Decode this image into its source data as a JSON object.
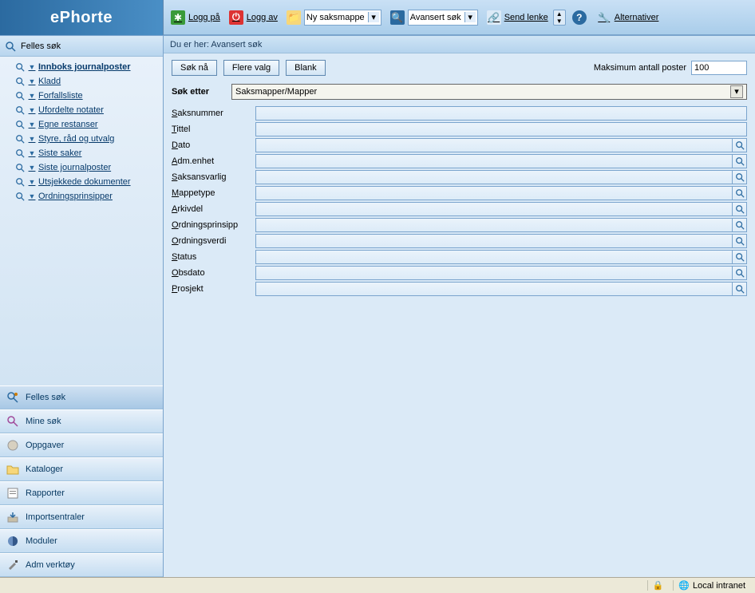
{
  "brand": "ePhorte",
  "toolbar": {
    "logon": "Logg på",
    "logoff": "Logg av",
    "newcase_sel": "Ny saksmappe",
    "advsearch_sel": "Avansert søk",
    "sendlink": "Send lenke",
    "alternatives": "Alternativer"
  },
  "sidebar": {
    "header": "Felles søk",
    "tree": [
      {
        "label": "Innboks journalposter",
        "bold": true
      },
      {
        "label": "Kladd"
      },
      {
        "label": "Forfallsliste"
      },
      {
        "label": "Ufordelte notater"
      },
      {
        "label": "Egne restanser"
      },
      {
        "label": "Styre, råd og utvalg"
      },
      {
        "label": "Siste saker"
      },
      {
        "label": "Siste journalposter"
      },
      {
        "label": "Utsjekkede dokumenter"
      },
      {
        "label": "Ordningsprinsipper"
      }
    ],
    "nav": [
      {
        "label": "Felles søk",
        "icon": "shared-search"
      },
      {
        "label": "Mine søk",
        "icon": "my-search"
      },
      {
        "label": "Oppgaver",
        "icon": "tasks"
      },
      {
        "label": "Kataloger",
        "icon": "folder"
      },
      {
        "label": "Rapporter",
        "icon": "report"
      },
      {
        "label": "Importsentraler",
        "icon": "import"
      },
      {
        "label": "Moduler",
        "icon": "module"
      },
      {
        "label": "Adm verktøy",
        "icon": "admin"
      }
    ]
  },
  "content": {
    "breadcrumb": "Du er her: Avansert søk",
    "buttons": {
      "search": "Søk nå",
      "more": "Flere valg",
      "blank": "Blank"
    },
    "maxlabel": "Maksimum antall poster",
    "maxvalue": "100",
    "searchforlabel": "Søk etter",
    "searchfor_value": "Saksmapper/Mapper",
    "fields": [
      {
        "label": "Saksnummer",
        "lookup": false
      },
      {
        "label": "Tittel",
        "lookup": false
      },
      {
        "label": "Dato",
        "lookup": true
      },
      {
        "label": "Adm.enhet",
        "lookup": true
      },
      {
        "label": "Saksansvarlig",
        "lookup": true
      },
      {
        "label": "Mappetype",
        "lookup": true
      },
      {
        "label": "Arkivdel",
        "lookup": true
      },
      {
        "label": "Ordningsprinsipp",
        "lookup": true
      },
      {
        "label": "Ordningsverdi",
        "lookup": true
      },
      {
        "label": "Status",
        "lookup": true
      },
      {
        "label": "Obsdato",
        "lookup": true
      },
      {
        "label": "Prosjekt",
        "lookup": true
      }
    ]
  },
  "statusbar": {
    "zone": "Local intranet"
  }
}
